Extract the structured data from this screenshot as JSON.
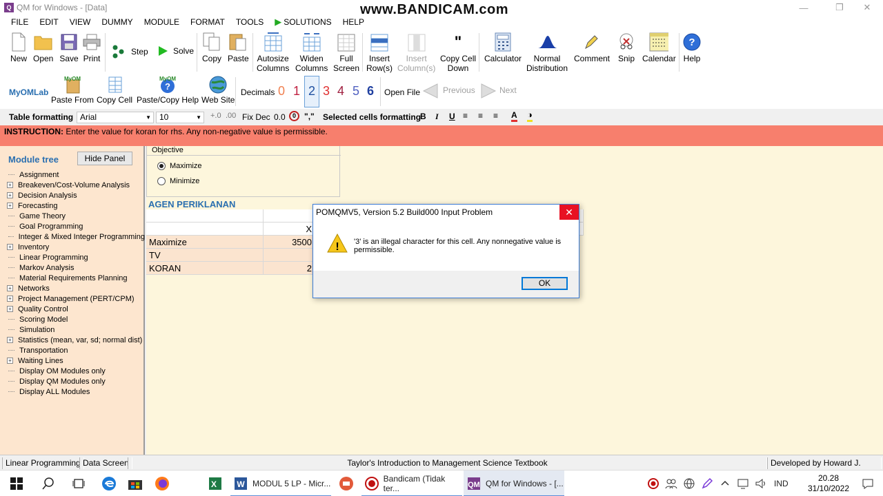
{
  "window": {
    "title": "QM for Windows - [Data]",
    "watermark": "www.BANDICAM.com"
  },
  "menu": [
    "FILE",
    "EDIT",
    "VIEW",
    "DUMMY",
    "MODULE",
    "FORMAT",
    "TOOLS",
    "SOLUTIONS",
    "HELP"
  ],
  "toolbar": {
    "new": "New",
    "open": "Open",
    "save": "Save",
    "print": "Print",
    "step": "Step",
    "solve": "Solve",
    "copy": "Copy",
    "paste": "Paste",
    "autosize_1": "Autosize",
    "autosize_2": "Columns",
    "widen_1": "Widen",
    "widen_2": "Columns",
    "full_1": "Full",
    "full_2": "Screen",
    "insert_row_1": "Insert",
    "insert_row_2": "Row(s)",
    "insert_col_1": "Insert",
    "insert_col_2": "Column(s)",
    "copy_down_1": "Copy Cell",
    "copy_down_2": "Down",
    "calculator": "Calculator",
    "normal_1": "Normal",
    "normal_2": "Distribution",
    "comment": "Comment",
    "snip": "Snip",
    "calendar": "Calendar",
    "help": "Help"
  },
  "toolbar2": {
    "myomlab": "MyOMLab",
    "paste_from": "Paste From",
    "copy_cell": "Copy Cell",
    "paste_copy_help": "Paste/Copy Help",
    "web_site": "Web Site",
    "decimals_label": "Decimals",
    "decimals": [
      "0",
      "1",
      "2",
      "3",
      "4",
      "5",
      "6"
    ],
    "open_file": "Open File",
    "previous": "Previous",
    "next": "Next"
  },
  "formatbar": {
    "table_formatting": "Table formatting",
    "font": "Arial",
    "size": "10",
    "fix_dec": "Fix Dec",
    "zero_zero": "0.0",
    "comma": "\",\"",
    "selected_cells": "Selected cells formatting"
  },
  "instruction": {
    "label": "INSTRUCTION:",
    "text": "Enter the value for koran for rhs. Any non-negative value is permissible."
  },
  "left_panel": {
    "title": "Module tree",
    "hide_button": "Hide Panel",
    "items": [
      {
        "label": "Assignment",
        "expandable": false
      },
      {
        "label": "Breakeven/Cost-Volume Analysis",
        "expandable": true
      },
      {
        "label": "Decision Analysis",
        "expandable": true
      },
      {
        "label": "Forecasting",
        "expandable": true
      },
      {
        "label": "Game Theory",
        "expandable": false
      },
      {
        "label": "Goal Programming",
        "expandable": false
      },
      {
        "label": "Integer & Mixed Integer Programming",
        "expandable": false
      },
      {
        "label": "Inventory",
        "expandable": true
      },
      {
        "label": "Linear Programming",
        "expandable": false
      },
      {
        "label": "Markov Analysis",
        "expandable": false
      },
      {
        "label": "Material Requirements Planning",
        "expandable": false
      },
      {
        "label": "Networks",
        "expandable": true
      },
      {
        "label": "Project Management (PERT/CPM)",
        "expandable": true
      },
      {
        "label": "Quality Control",
        "expandable": true
      },
      {
        "label": "Scoring Model",
        "expandable": false
      },
      {
        "label": "Simulation",
        "expandable": false
      },
      {
        "label": "Statistics (mean, var, sd; normal dist)",
        "expandable": true
      },
      {
        "label": "Transportation",
        "expandable": false
      },
      {
        "label": "Waiting Lines",
        "expandable": true
      },
      {
        "label": "Display OM Modules only",
        "expandable": false
      },
      {
        "label": "Display QM Modules only",
        "expandable": false
      },
      {
        "label": "Display ALL Modules",
        "expandable": false
      }
    ]
  },
  "data_screen": {
    "objective_title": "Objective",
    "maximize": "Maximize",
    "minimize": "Minimize",
    "selected": "maximize",
    "problem_title": "AGEN PERIKLANAN",
    "column_header": "X",
    "rows": [
      {
        "name": "Maximize",
        "value": "3500"
      },
      {
        "name": "TV",
        "value": ""
      },
      {
        "name": "KORAN",
        "value": "2"
      }
    ]
  },
  "dialog": {
    "title": "POMQMV5, Version 5.2 Build000 Input Problem",
    "message": "'3' is an illegal character for this cell. Any nonnegative value is permissible.",
    "ok": "OK",
    "close": "✕"
  },
  "statusbar": {
    "module": "Linear Programming",
    "screen": "Data Screen",
    "textbook": "Taylor's Introduction to Management Science Textbook",
    "developer": "Developed by Howard J. Weiss"
  },
  "taskbar": {
    "apps": [
      {
        "label": "MODUL 5  LP - Micr...",
        "icon": "word-icon"
      },
      {
        "label": "Bandicam (Tidak ter...",
        "icon": "bandicam-icon"
      },
      {
        "label": "QM for Windows - [...",
        "icon": "qm-icon"
      }
    ],
    "language": "IND",
    "time": "20.28",
    "date": "31/10/2022"
  },
  "colors": {
    "instruction_bg": "#f77f6d",
    "panel_bg": "#fde6cf",
    "data_bg": "#fdf6dc",
    "accent_blue": "#2a6fb0",
    "close_red": "#e81123"
  }
}
